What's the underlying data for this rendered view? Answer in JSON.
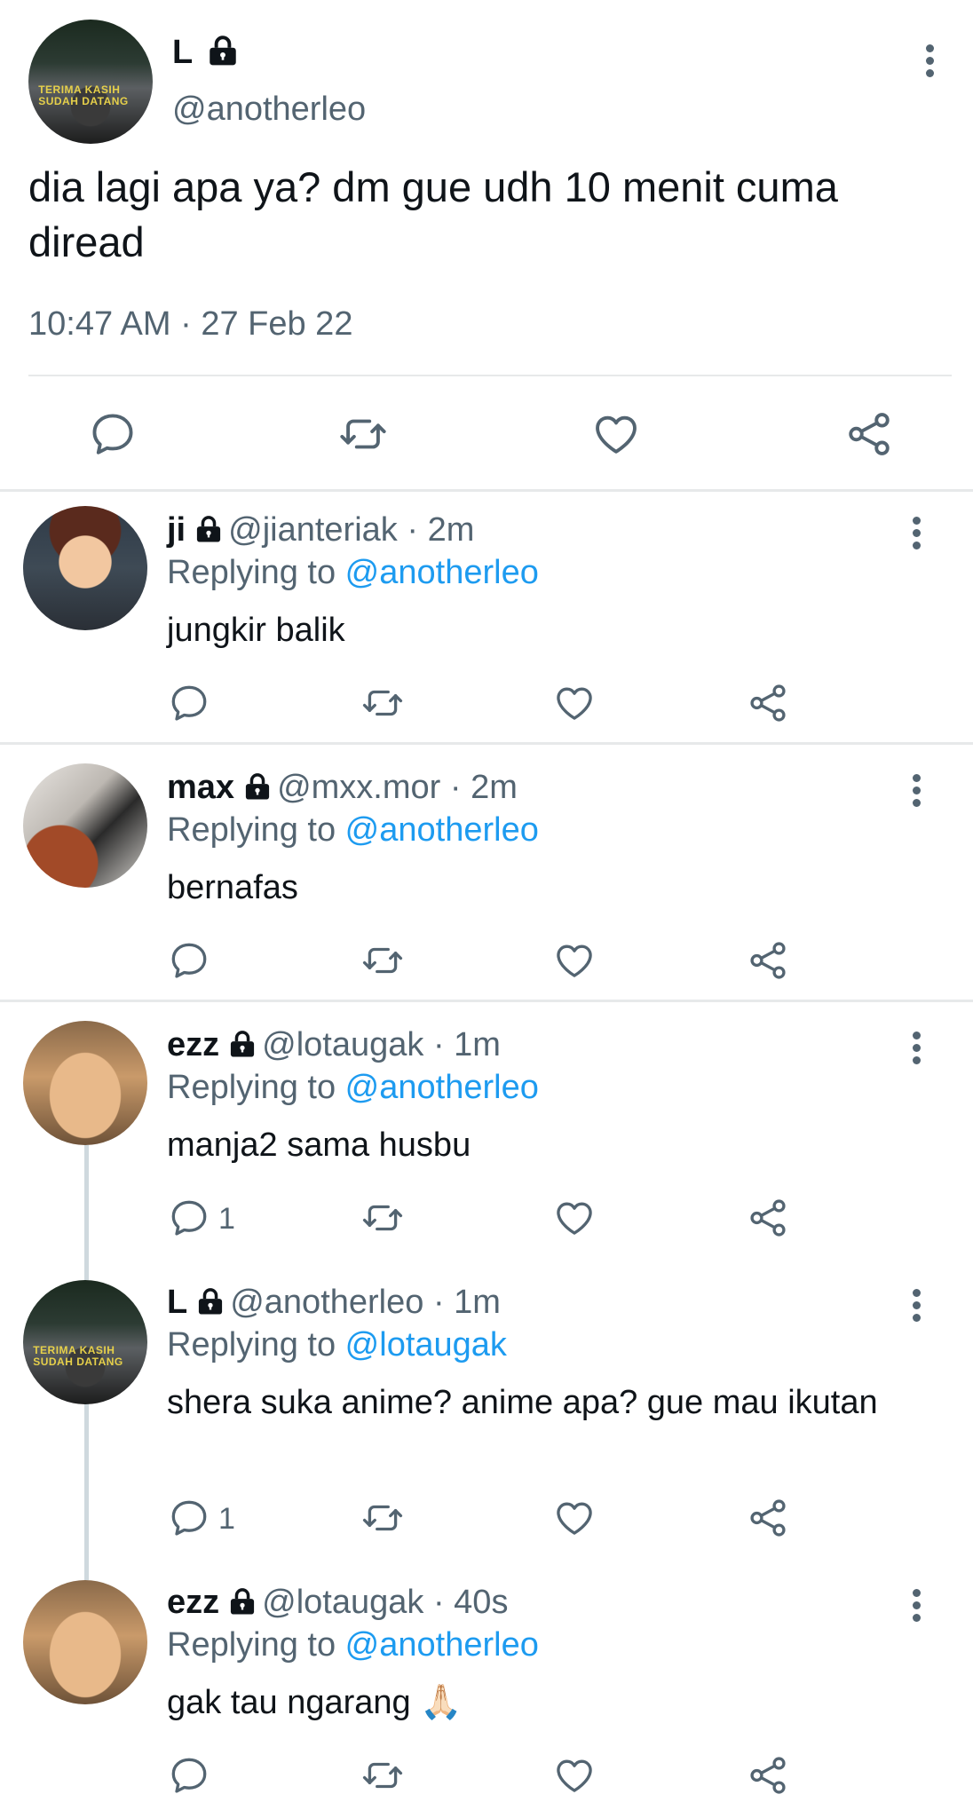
{
  "main_tweet": {
    "name": "L",
    "handle": "@anotherleo",
    "text": "dia lagi apa ya? dm gue udh 10 menit cuma diread",
    "timestamp": "10:47 AM · 27 Feb 22",
    "avatar_text": [
      "TERIMA KASIH",
      "SUDAH DATANG"
    ]
  },
  "replies": [
    {
      "name": "ji",
      "handle": "@jianteriak",
      "time": "2m",
      "replying_prefix": "Replying to ",
      "replying_to": "@anotherleo",
      "text": "jungkir balik",
      "reply_count": ""
    },
    {
      "name": "max",
      "handle": "@mxx.mor",
      "time": "2m",
      "replying_prefix": "Replying to ",
      "replying_to": "@anotherleo",
      "text": "bernafas",
      "reply_count": ""
    },
    {
      "name": "ezz",
      "handle": "@lotaugak",
      "time": "1m",
      "replying_prefix": "Replying to ",
      "replying_to": "@anotherleo",
      "text": "manja2 sama husbu",
      "reply_count": "1"
    },
    {
      "name": "L",
      "handle": "@anotherleo",
      "time": "1m",
      "replying_prefix": "Replying to ",
      "replying_to": "@lotaugak",
      "text": "shera suka anime? anime apa? gue mau ikutan",
      "reply_count": "1"
    },
    {
      "name": "ezz",
      "handle": "@lotaugak",
      "time": "40s",
      "replying_prefix": "Replying to ",
      "replying_to": "@anotherleo",
      "text": "gak tau ngarang 🙏🏻",
      "reply_count": ""
    }
  ],
  "separator": " · ",
  "icons": {
    "reply": "reply-icon",
    "retweet": "retweet-icon",
    "like": "heart-icon",
    "share": "share-icon",
    "more": "more-vertical-icon",
    "lock": "lock-icon"
  },
  "colors": {
    "text": "#0f1419",
    "secondary": "#536471",
    "link": "#1d9bf0",
    "divider": "#e7e9ea"
  }
}
